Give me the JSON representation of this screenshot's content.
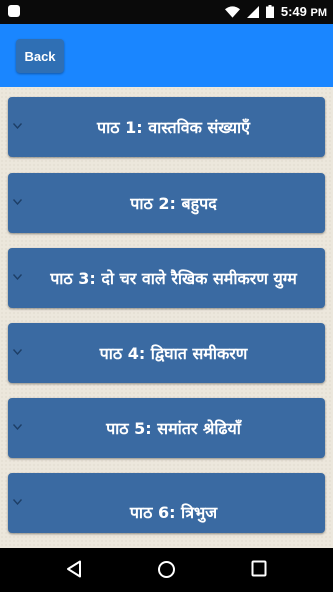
{
  "status_bar": {
    "time": "5:49",
    "time_suffix": "PM",
    "icons": [
      "app-notification-icon",
      "wifi-icon",
      "cell-signal-icon",
      "battery-icon"
    ]
  },
  "header": {
    "back_label": "Back"
  },
  "lessons": [
    {
      "label": "पाठ 1: वास्तविक संख्याएँ"
    },
    {
      "label": "पाठ 2: बहुपद"
    },
    {
      "label": "पाठ 3: दो चर वाले रैखिक समीकरण युग्म"
    },
    {
      "label": "पाठ 4: द्विघात समीकरण"
    },
    {
      "label": "पाठ 5: समांतर श्रेढियाँ"
    },
    {
      "label": "पाठ 6: त्रिभुज"
    }
  ],
  "nav_bar": {
    "icons": [
      "back-triangle-icon",
      "home-circle-icon",
      "recents-square-icon"
    ]
  },
  "colors": {
    "header": "#1a86ff",
    "card": "#3a6aa2",
    "back_button": "#2f6fb4",
    "background": "#ece7dc"
  }
}
